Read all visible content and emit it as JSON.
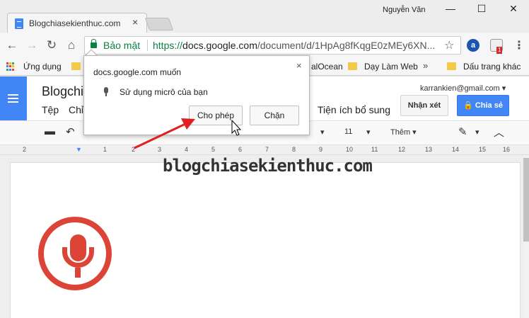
{
  "window": {
    "tab_title": "Blogchiasekienthuc.com",
    "tab_close": "×",
    "profile_name": "Nguyễn Văn",
    "minimize": "—",
    "maximize": "☐",
    "close": "✕"
  },
  "toolbar": {
    "back": "←",
    "forward": "→",
    "reload": "↻",
    "home": "⌂",
    "secure_label": "Bảo mật",
    "url_scheme": "https://",
    "url_host": "docs.google.com",
    "url_path": "/document/d/1HpAg8fKqgE0zMEy6XN...",
    "bookmark_star": "☆",
    "extension_badge": "1",
    "menu": "⋮"
  },
  "bookmarks": {
    "apps_label": "Ứng dụng",
    "items": [
      "alOcean",
      "Dạy Làm Web"
    ],
    "more": "»",
    "other_bookmarks": "Dấu trang khác"
  },
  "docs": {
    "title": "Blogchi",
    "menu": [
      "Tệp",
      "Chỉ",
      "Tiện ích bổ sung"
    ],
    "account": "karrankien@gmail.com",
    "comments_label": "Nhận xét",
    "share_label": "Chia sẻ",
    "font_size": "11",
    "more_label": "Thêm",
    "ruler_marks": [
      "2",
      "1",
      "1",
      "2",
      "3",
      "4",
      "5",
      "6",
      "7",
      "8",
      "9",
      "10",
      "11",
      "12",
      "13",
      "14",
      "15",
      "16"
    ]
  },
  "watermark": "blogchiasekienthuc.com",
  "permission_popup": {
    "site_text": "docs.google.com muốn",
    "close": "×",
    "request_text": "Sử dụng micrô của bạn",
    "allow_label": "Cho phép",
    "block_label": "Chặn"
  },
  "colors": {
    "docs_blue": "#4285f4",
    "secure_green": "#0b8043",
    "mic_red": "#db4437",
    "arrow_red": "#e02020"
  }
}
